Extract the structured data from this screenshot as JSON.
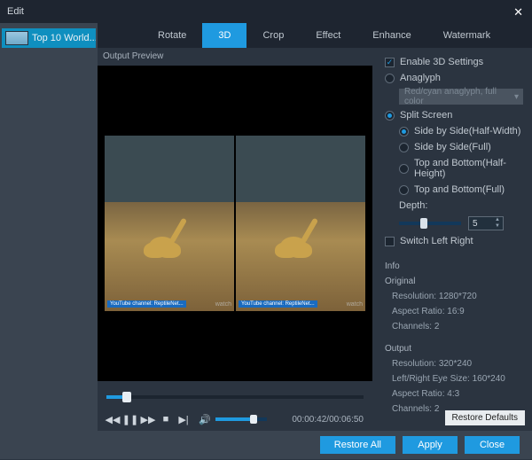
{
  "window": {
    "title": "Edit"
  },
  "sidebar": {
    "items": [
      {
        "label": "Top 10 World..."
      }
    ]
  },
  "tabs": [
    {
      "key": "rotate",
      "label": "Rotate",
      "active": false
    },
    {
      "key": "3d",
      "label": "3D",
      "active": true
    },
    {
      "key": "crop",
      "label": "Crop",
      "active": false
    },
    {
      "key": "effect",
      "label": "Effect",
      "active": false
    },
    {
      "key": "enhance",
      "label": "Enhance",
      "active": false
    },
    {
      "key": "watermark",
      "label": "Watermark",
      "active": false
    }
  ],
  "preview": {
    "header": "Output Preview",
    "watermark_left": "YouTube channel: ReptileNet...",
    "watermark_right": "watch",
    "time_current": "00:00:42",
    "time_total": "00:06:50"
  },
  "settings": {
    "enable_label": "Enable 3D Settings",
    "enable_checked": true,
    "anaglyph": {
      "label": "Anaglyph",
      "selected": false,
      "dropdown_text": "Red/cyan anaglyph, full color"
    },
    "split": {
      "label": "Split Screen",
      "selected": true,
      "options": [
        {
          "label": "Side by Side(Half-Width)",
          "selected": true
        },
        {
          "label": "Side by Side(Full)",
          "selected": false
        },
        {
          "label": "Top and Bottom(Half-Height)",
          "selected": false
        },
        {
          "label": "Top and Bottom(Full)",
          "selected": false
        }
      ]
    },
    "depth": {
      "label": "Depth:",
      "value": "5"
    },
    "switch": {
      "label": "Switch Left Right",
      "checked": false
    }
  },
  "info": {
    "header": "Info",
    "original": {
      "title": "Original",
      "resolution_label": "Resolution:",
      "resolution_value": "1280*720",
      "aspect_label": "Aspect Ratio:",
      "aspect_value": "16:9",
      "channels_label": "Channels:",
      "channels_value": "2"
    },
    "output": {
      "title": "Output",
      "resolution_label": "Resolution:",
      "resolution_value": "320*240",
      "eye_label": "Left/Right Eye Size:",
      "eye_value": "160*240",
      "aspect_label": "Aspect Ratio:",
      "aspect_value": "4:3",
      "channels_label": "Channels:",
      "channels_value": "2"
    }
  },
  "buttons": {
    "restore_defaults": "Restore Defaults",
    "restore_all": "Restore All",
    "apply": "Apply",
    "close": "Close"
  }
}
